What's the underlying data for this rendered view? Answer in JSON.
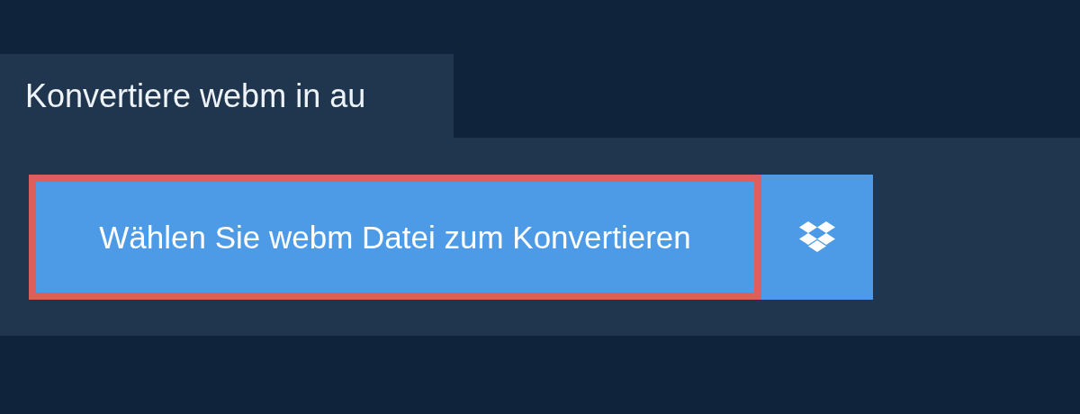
{
  "tab": {
    "title": "Konvertiere webm in au"
  },
  "upload": {
    "label": "Wählen Sie webm Datei zum Konvertieren",
    "highlighted": true
  }
}
